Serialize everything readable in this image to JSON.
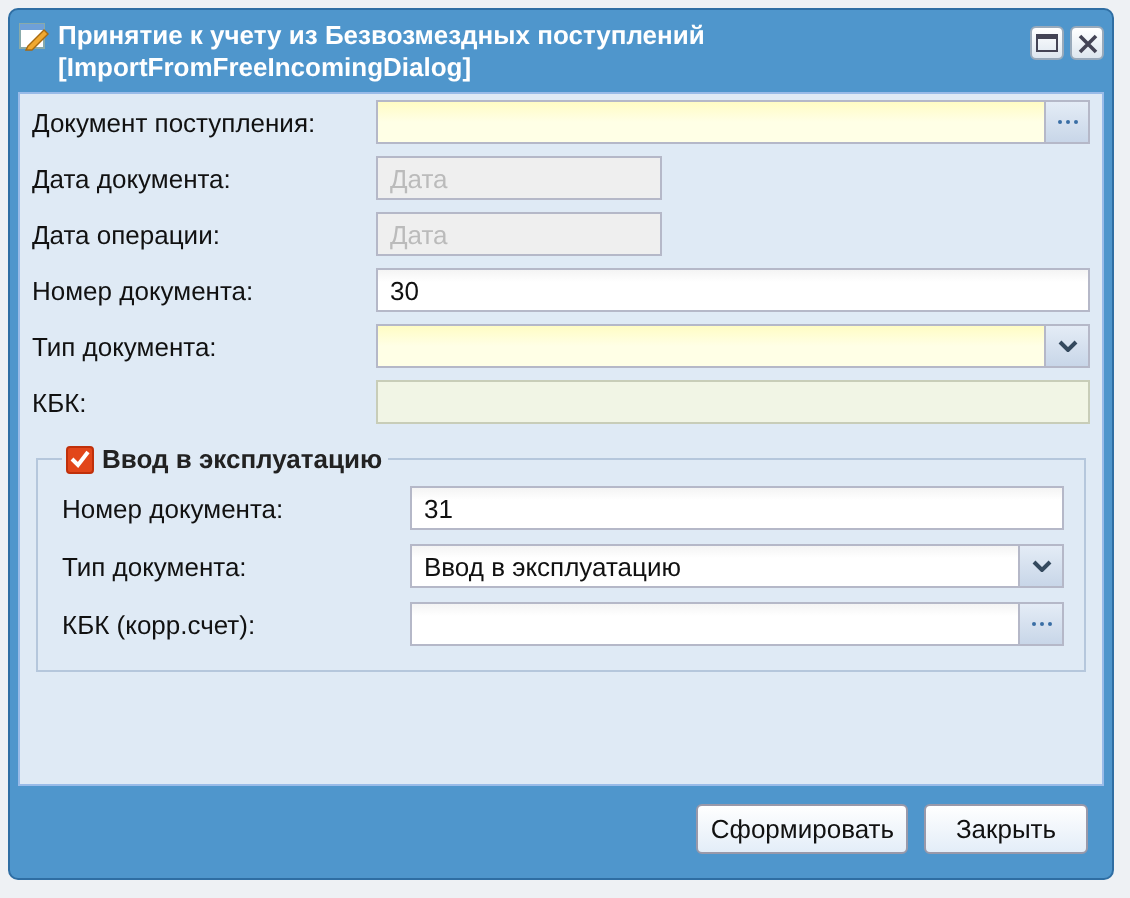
{
  "window": {
    "title": "Принятие к учету из Безвозмездных поступлений [ImportFromFreeIncomingDialog]"
  },
  "fields": [
    {
      "label": "Документ поступления:",
      "kind": "picker",
      "required": true,
      "disabled": false
    },
    {
      "label": "Дата документа:",
      "kind": "date",
      "placeholder": "Дата",
      "required": false,
      "disabled": true
    },
    {
      "label": "Дата операции:",
      "kind": "date",
      "placeholder": "Дата",
      "required": false,
      "disabled": true
    },
    {
      "label": "Номер документа:",
      "kind": "text",
      "value": "30",
      "required": false,
      "disabled": false
    },
    {
      "label": "Тип документа:",
      "kind": "combo",
      "required": true,
      "disabled": false
    },
    {
      "label": "КБК:",
      "kind": "text",
      "required": true,
      "disabled": true
    }
  ],
  "section": {
    "label": "Ввод в эксплуатацию",
    "checked": true,
    "fields": [
      {
        "label": "Номер документа:",
        "kind": "text",
        "value": "31",
        "required": false,
        "disabled": false
      },
      {
        "label": "Тип документа:",
        "kind": "combo",
        "value": "Ввод в эксплуатацию",
        "required": false,
        "disabled": false
      },
      {
        "label": "КБК (корр.счет):",
        "kind": "picker",
        "required": false,
        "disabled": false
      }
    ]
  },
  "buttons": [
    "Сформировать",
    "Закрыть"
  ]
}
